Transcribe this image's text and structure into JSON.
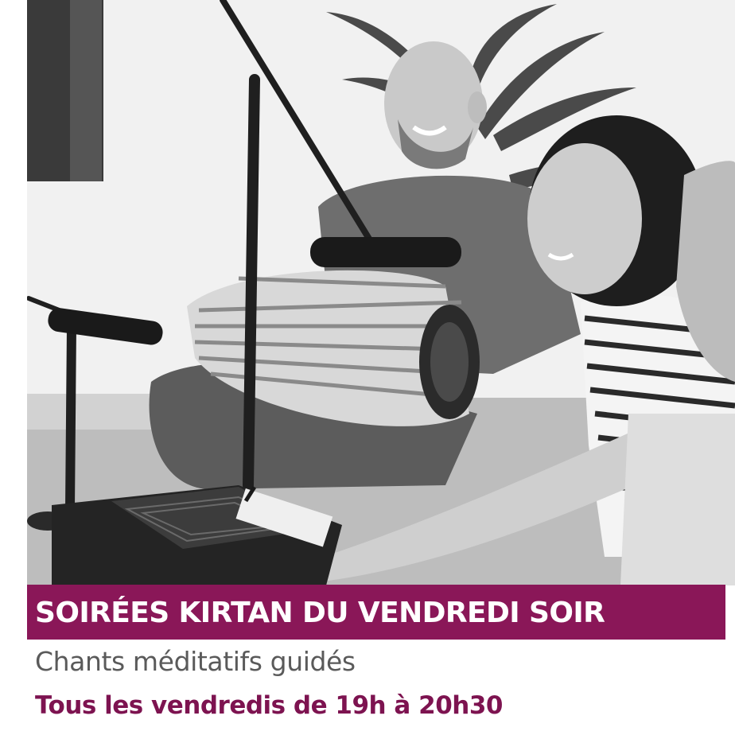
{
  "banner": {
    "title": "SOIRÉES KIRTAN DU VENDREDI SOIR",
    "background_color": "#8a1758"
  },
  "subtitle": "Chants méditatifs guidés",
  "schedule": "Tous les vendredis de 19h à 20h30",
  "colors": {
    "accent": "#7d1350",
    "subtitle_text": "#5a5a5a",
    "banner_text": "#ffffff"
  }
}
